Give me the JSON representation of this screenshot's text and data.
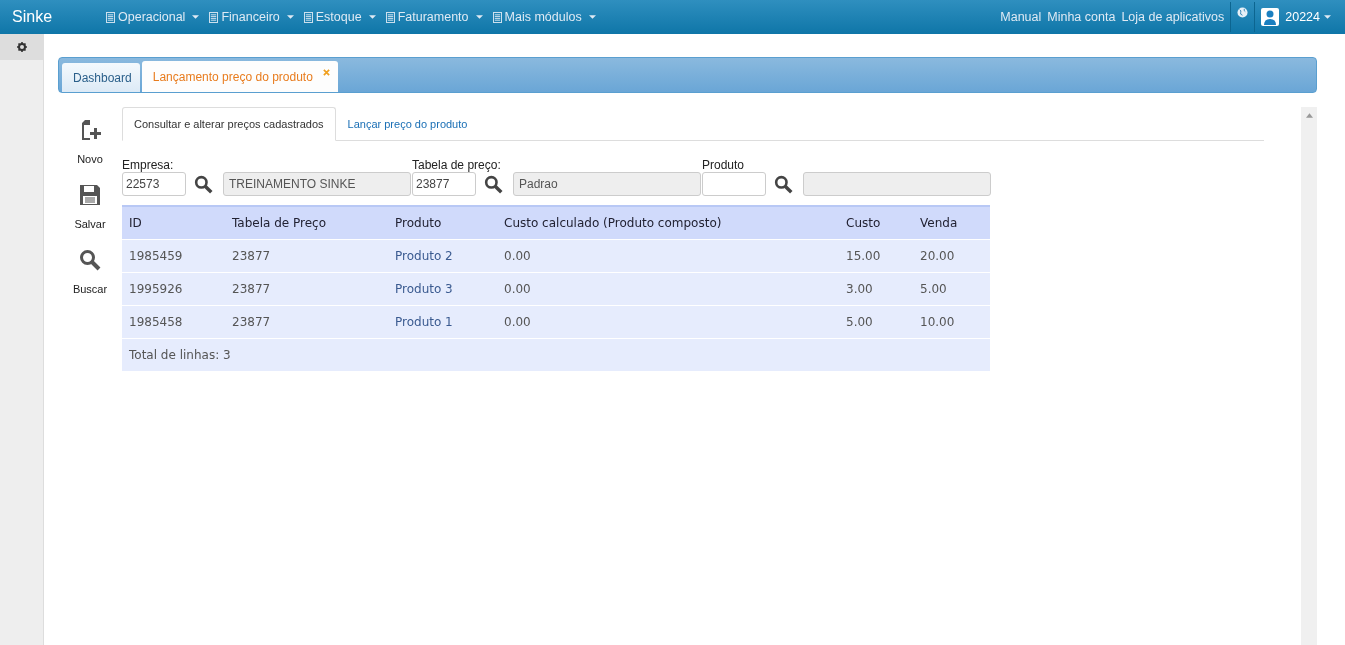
{
  "navbar": {
    "brand": "Sinke",
    "menus": [
      {
        "label": "Operacional"
      },
      {
        "label": "Financeiro"
      },
      {
        "label": "Estoque"
      },
      {
        "label": "Faturamento"
      },
      {
        "label": "Mais módulos"
      }
    ],
    "links": [
      "Manual",
      "Minha conta",
      "Loja de aplicativos"
    ],
    "user": "20224"
  },
  "page_tabs": [
    {
      "label": "Dashboard",
      "selected": false,
      "closable": false
    },
    {
      "label": "Lançamento preço do produto",
      "selected": true,
      "closable": true
    }
  ],
  "toolbar": [
    {
      "kind": "new",
      "label": "Novo"
    },
    {
      "kind": "save",
      "label": "Salvar"
    },
    {
      "kind": "search",
      "label": "Buscar"
    }
  ],
  "sub_tabs": [
    {
      "label": "Consultar e alterar preços cadastrados",
      "selected": true
    },
    {
      "label": "Lançar preço do produto",
      "selected": false
    }
  ],
  "filters": [
    {
      "label": "Empresa:",
      "code": "22573",
      "description": "TREINAMENTO SINKE"
    },
    {
      "label": "Tabela de preço:",
      "code": "23877",
      "description": "Padrao"
    },
    {
      "label": "Produto"
    }
  ],
  "table": {
    "columns": [
      "ID",
      "Tabela de Preço",
      "Produto",
      "Custo calculado (Produto composto)",
      "Custo",
      "Venda"
    ],
    "rows": [
      [
        "1985459",
        "23877",
        "Produto 2",
        "0.00",
        "15.00",
        "20.00"
      ],
      [
        "1995926",
        "23877",
        "Produto 3",
        "0.00",
        "3.00",
        "5.00"
      ],
      [
        "1985458",
        "23877",
        "Produto 1",
        "0.00",
        "5.00",
        "10.00"
      ]
    ],
    "footer": "Total de linhas: 3"
  }
}
